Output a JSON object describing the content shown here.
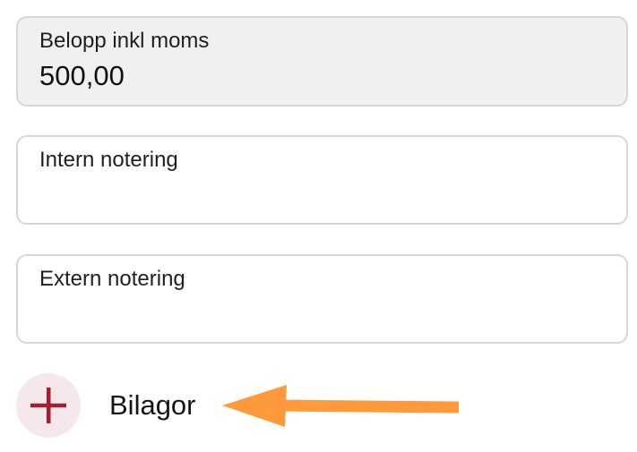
{
  "form": {
    "amount_field": {
      "label": "Belopp inkl moms",
      "value": "500,00"
    },
    "internal_note_field": {
      "label": "Intern notering",
      "value": ""
    },
    "external_note_field": {
      "label": "Extern notering",
      "value": ""
    },
    "attachments": {
      "label": "Bilagor",
      "icon": "plus-icon"
    }
  },
  "colors": {
    "plus_icon": "#a02030",
    "plus_button_bg": "#f6e8ea",
    "annotation_arrow": "#ff9a3c",
    "field_border": "#d6d6d6",
    "filled_field_bg": "#f0f0f0"
  }
}
